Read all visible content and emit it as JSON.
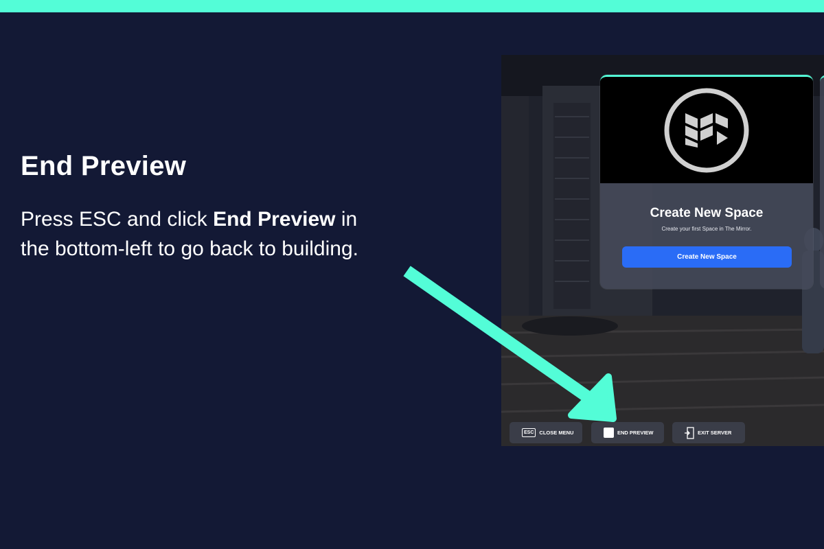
{
  "colors": {
    "accent": "#53fdd7",
    "background": "#131935",
    "primary_button": "#2a6cf6"
  },
  "slide": {
    "title": "End Preview",
    "body_prefix": "Press ESC and click ",
    "body_bold": "End Preview",
    "body_suffix": " in the bottom-left to go back to building."
  },
  "modal": {
    "logo_icon": "the-mirror-logo-icon",
    "title": "Create New Space",
    "subtitle": "Create your first Space in The Mirror.",
    "button_label": "Create New Space"
  },
  "menu": {
    "close": {
      "key": "ESC",
      "label": "CLOSE MENU"
    },
    "end_preview": {
      "icon": "square-icon",
      "label": "END PREVIEW"
    },
    "exit_server": {
      "icon": "exit-door-icon",
      "label": "EXIT SERVER"
    }
  },
  "annotation": {
    "icon": "pointer-arrow-icon"
  }
}
